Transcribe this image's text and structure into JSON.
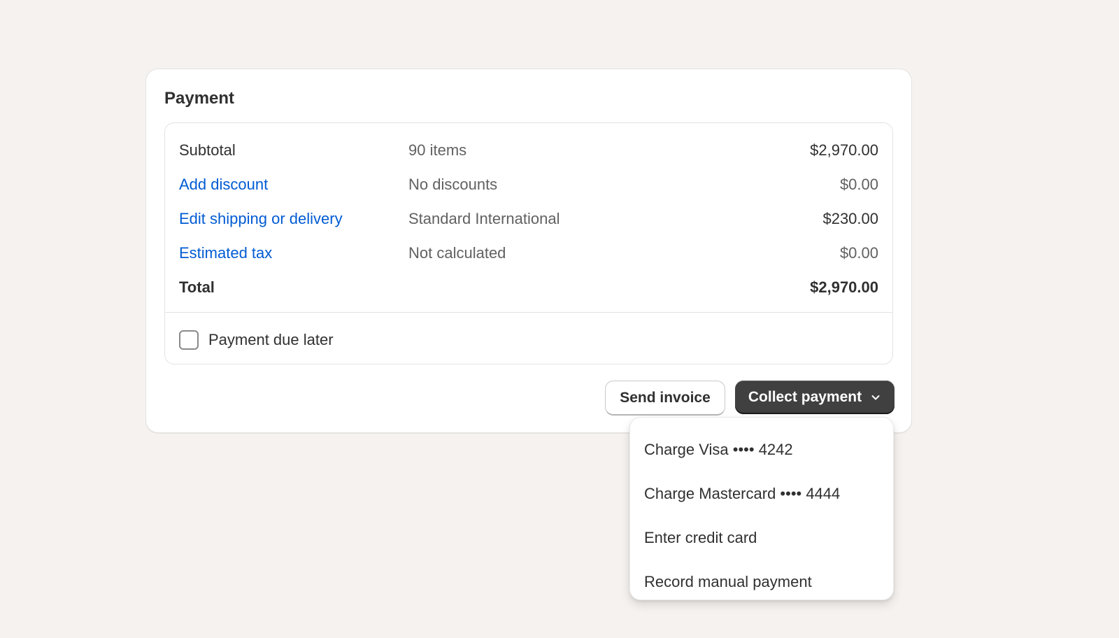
{
  "payment": {
    "title": "Payment",
    "rows": [
      {
        "label": "Subtotal",
        "detail": "90 items",
        "amount": "$2,970.00"
      },
      {
        "label": "Add discount",
        "detail": "No discounts",
        "amount": "$0.00"
      },
      {
        "label": "Edit shipping or delivery",
        "detail": "Standard International",
        "amount": "$230.00"
      },
      {
        "label": "Estimated tax",
        "detail": "Not calculated",
        "amount": "$0.00"
      }
    ],
    "total": {
      "label": "Total",
      "amount": "$2,970.00"
    },
    "payment_due_later": {
      "label": "Payment due later",
      "checked": false
    }
  },
  "actions": {
    "send_invoice": "Send invoice",
    "collect_payment": "Collect payment",
    "collect_icon": "chevron-down-icon"
  },
  "menu": {
    "items": [
      "Charge Visa •••• 4242",
      "Charge Mastercard •••• 4444",
      "Enter credit card",
      "Record manual payment"
    ]
  },
  "colors": {
    "link": "#005bd3",
    "primary_button": "#404040",
    "background": "#f5f2ef"
  }
}
